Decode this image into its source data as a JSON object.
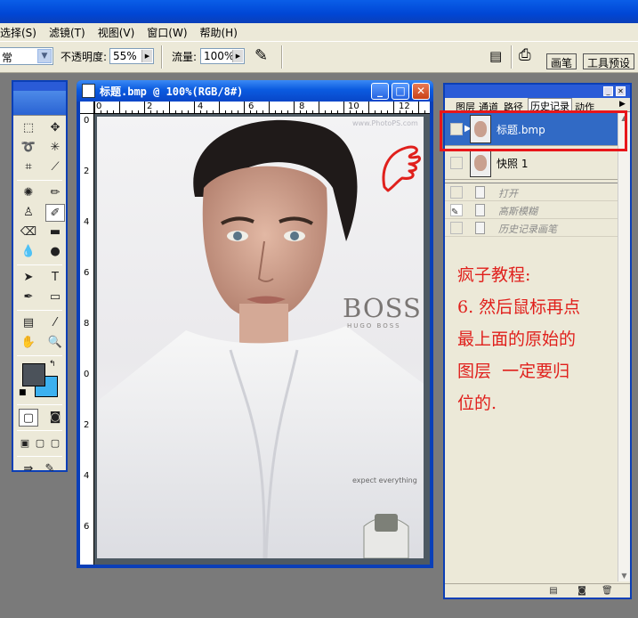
{
  "menubar": {
    "items": [
      "选择(S)",
      "滤镜(T)",
      "视图(V)",
      "窗口(W)",
      "帮助(H)"
    ]
  },
  "options": {
    "mode_value": "常",
    "opacity_label": "不透明度:",
    "opacity_value": "55%",
    "flow_label": "流量:",
    "flow_value": "100%",
    "tab_brush": "画笔",
    "tab_presets": "工具预设"
  },
  "document": {
    "title": "标题.bmp @ 100%(RGB/8#)",
    "hruler_labels": [
      "0",
      "2",
      "4",
      "6",
      "8",
      "10",
      "12"
    ],
    "vruler_labels": [
      "0",
      "2",
      "4",
      "6",
      "8",
      "0",
      "2",
      "4",
      "6"
    ],
    "photo_text": {
      "watermark": "www.PhotoPS.com",
      "brand": "BOSS",
      "sub_brand": "HUGO BOSS",
      "slogan": "expect everything"
    }
  },
  "panel": {
    "tabs": [
      "图层",
      "通道",
      "路径",
      "历史记录",
      "动作"
    ],
    "snapshots": [
      {
        "label": "标题.bmp",
        "selected": true
      },
      {
        "label": "快照 1",
        "selected": false
      }
    ],
    "history": [
      {
        "label": "打开"
      },
      {
        "label": "高斯模糊"
      },
      {
        "label": "历史记录画笔"
      }
    ],
    "note_lines": [
      "疯子教程:",
      "6. 然后鼠标再点",
      "最上面的原始的",
      "图层  一定要归",
      "位的."
    ]
  },
  "colors": {
    "foreground": "#4b525a",
    "background": "#3db1ef",
    "highlight": "#e8161a",
    "note_text": "#e0201c"
  }
}
